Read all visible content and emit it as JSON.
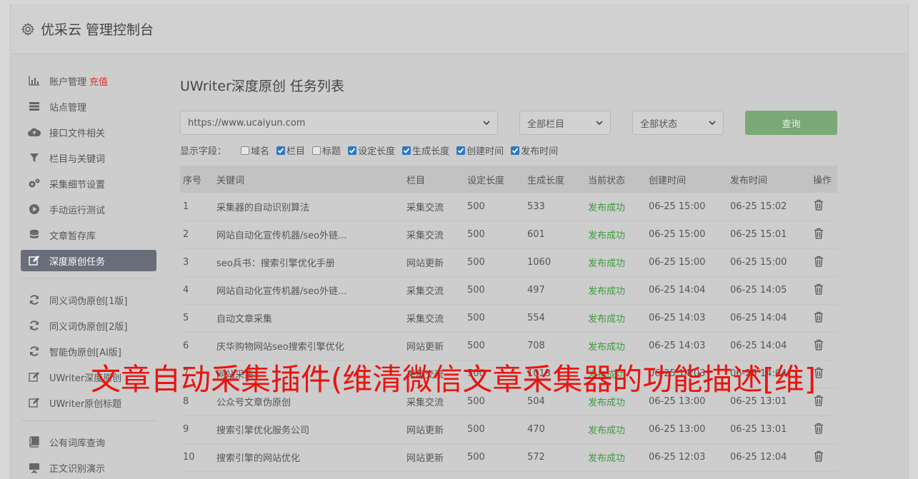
{
  "app": {
    "title": "优采云 管理控制台"
  },
  "sidebar": {
    "items": [
      {
        "label": "账户管理",
        "extra": "充值",
        "icon": "bar-chart-icon"
      },
      {
        "label": "站点管理",
        "icon": "server-icon"
      },
      {
        "label": "接口文件相关",
        "icon": "cloud-upload-icon"
      },
      {
        "label": "栏目与关键词",
        "icon": "filter-icon"
      },
      {
        "label": "采集细节设置",
        "icon": "cogs-icon"
      },
      {
        "label": "手动运行测试",
        "icon": "play-icon"
      },
      {
        "label": "文章暂存库",
        "icon": "database-icon"
      },
      {
        "label": "深度原创任务",
        "icon": "edit-icon",
        "active": true
      },
      {
        "label": "同义词伪原创[1版]",
        "icon": "refresh-icon"
      },
      {
        "label": "同义词伪原创[2版]",
        "icon": "refresh-icon"
      },
      {
        "label": "智能伪原创[AI版]",
        "icon": "refresh-icon"
      },
      {
        "label": "UWriter深度原创",
        "icon": "edit-icon"
      },
      {
        "label": "UWriter原创标题",
        "icon": "edit-icon"
      },
      {
        "label": "公有词库查询",
        "icon": "book-icon"
      },
      {
        "label": "正文识别演示",
        "icon": "monitor-icon"
      }
    ]
  },
  "main": {
    "title": "UWriter深度原创 任务列表",
    "filters": {
      "site": "https://www.ucaiyun.com",
      "column": "全部栏目",
      "status": "全部状态",
      "query_label": "查询"
    },
    "fields": {
      "label": "显示字段：",
      "options": [
        {
          "label": "域名",
          "checked": false
        },
        {
          "label": "栏目",
          "checked": true
        },
        {
          "label": "标题",
          "checked": false
        },
        {
          "label": "设定长度",
          "checked": true
        },
        {
          "label": "生成长度",
          "checked": true
        },
        {
          "label": "创建时间",
          "checked": true
        },
        {
          "label": "发布时间",
          "checked": true
        }
      ]
    },
    "table": {
      "headers": [
        "序号",
        "关键词",
        "栏目",
        "设定长度",
        "生成长度",
        "当前状态",
        "创建时间",
        "发布时间",
        "操作"
      ],
      "rows": [
        [
          "1",
          "采集器的自动识别算法",
          "采集交流",
          "500",
          "533",
          "发布成功",
          "06-25 15:00",
          "06-25 15:02"
        ],
        [
          "2",
          "网站自动化宣传机器/seo外链...",
          "采集交流",
          "500",
          "601",
          "发布成功",
          "06-25 15:00",
          "06-25 15:01"
        ],
        [
          "3",
          "seo兵书：搜索引擎优化手册",
          "网站更新",
          "500",
          "1060",
          "发布成功",
          "06-25 15:00",
          "06-25 15:00"
        ],
        [
          "4",
          "网站自动化宣传机器/seo外链...",
          "采集交流",
          "500",
          "497",
          "发布成功",
          "06-25 14:04",
          "06-25 14:05"
        ],
        [
          "5",
          "自动文章采集",
          "采集交流",
          "500",
          "554",
          "发布成功",
          "06-25 14:03",
          "06-25 14:04"
        ],
        [
          "6",
          "庆华购物网站seo搜索引擎优化",
          "网站更新",
          "500",
          "708",
          "发布成功",
          "06-25 14:03",
          "06-25 14:04"
        ],
        [
          "7",
          "网站采集",
          "采集交流",
          "500",
          "1013",
          "发布成功",
          "06-25 14:03",
          "06-25 14:04"
        ],
        [
          "8",
          "公众号文章伪原创",
          "采集交流",
          "500",
          "504",
          "发布成功",
          "06-25 13:00",
          "06-25 13:01"
        ],
        [
          "9",
          "搜索引擎优化服务公司",
          "网站更新",
          "500",
          "470",
          "发布成功",
          "06-25 13:00",
          "06-25 13:01"
        ],
        [
          "10",
          "搜索引擎的网站优化",
          "网站更新",
          "500",
          "572",
          "发布成功",
          "06-25 12:03",
          "06-25 12:04"
        ]
      ]
    }
  },
  "overlay": {
    "text": "文章自动采集插件(维清微信文章采集器的功能描述[维]"
  },
  "colors": {
    "active_nav": "#6a6e7a",
    "success": "#3c9a3c",
    "query_button": "#7aa877",
    "overlay": "#e8140f",
    "recharge": "#e0302c"
  }
}
